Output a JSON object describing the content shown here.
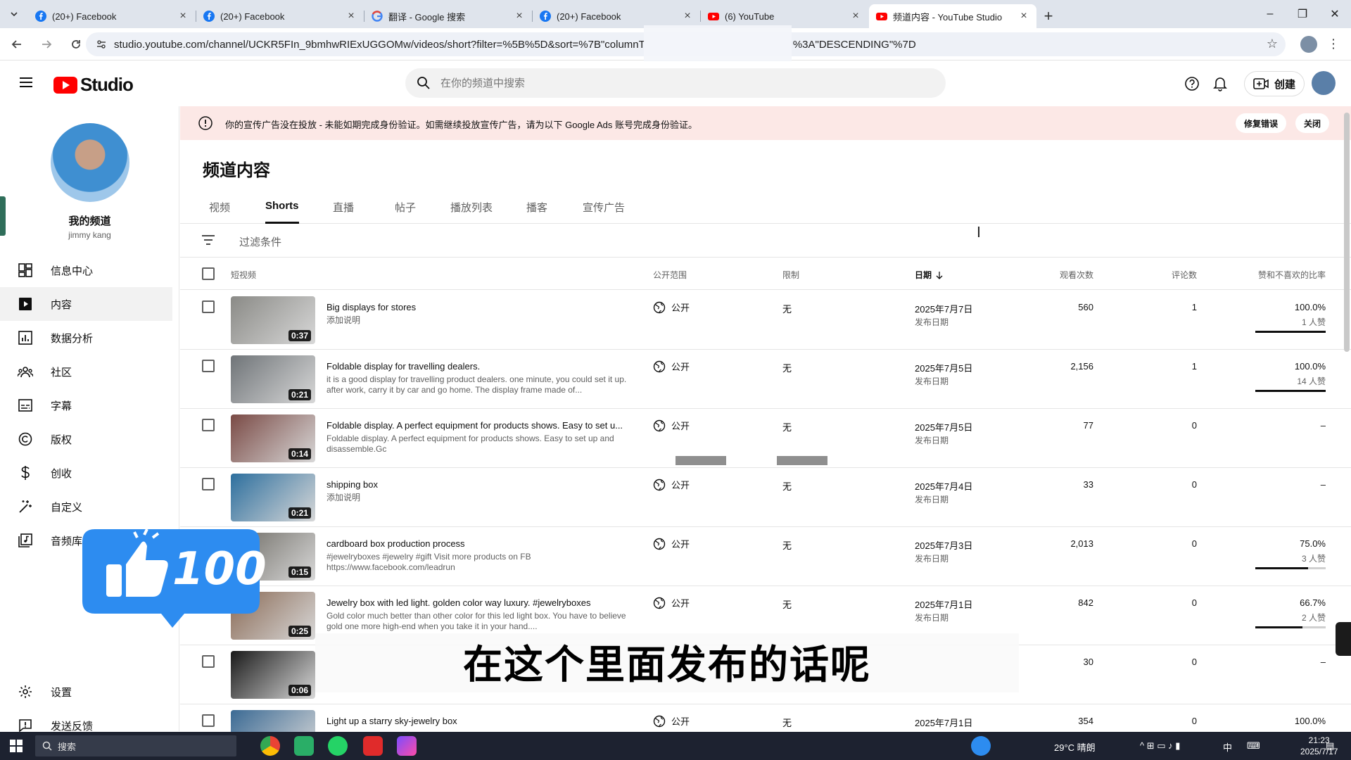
{
  "browser": {
    "tabs": [
      {
        "title": "(20+) Facebook",
        "icon": "facebook-icon"
      },
      {
        "title": "(20+) Facebook",
        "icon": "facebook-icon"
      },
      {
        "title": "翻译 - Google 搜索",
        "icon": "google-icon"
      },
      {
        "title": "(20+) Facebook",
        "icon": "facebook-icon"
      },
      {
        "title": "(6) YouTube",
        "icon": "youtube-icon"
      },
      {
        "title": "频道内容 - YouTube Studio",
        "icon": "youtube-studio-icon"
      }
    ],
    "url_start": "studio.youtube.com/channel/UCKR5FIn_9bmhwRIExUGGOMw/videos/short?filter=%5B%5D&sort=%7B\"columnT",
    "url_end": "%3A\"DESCENDING\"%7D"
  },
  "header": {
    "logo_text": "Studio",
    "search_placeholder": "在你的频道中搜索",
    "create_label": "创建"
  },
  "sidebar": {
    "channel_title": "我的频道",
    "channel_name": "jimmy kang",
    "items": [
      {
        "label": "信息中心"
      },
      {
        "label": "内容"
      },
      {
        "label": "数据分析"
      },
      {
        "label": "社区"
      },
      {
        "label": "字幕"
      },
      {
        "label": "版权"
      },
      {
        "label": "创收"
      },
      {
        "label": "自定义"
      },
      {
        "label": "音频库"
      }
    ],
    "settings_label": "设置",
    "feedback_label": "发送反馈"
  },
  "banner": {
    "message": "你的宣传广告没在投放 - 未能如期完成身份验证。如需继续投放宣传广告，请为以下 Google Ads 账号完成身份验证。",
    "fix_label": "修复错误",
    "close_label": "关闭"
  },
  "content": {
    "page_title": "频道内容",
    "tabs": [
      "视频",
      "Shorts",
      "直播",
      "帖子",
      "播放列表",
      "播客",
      "宣传广告"
    ],
    "filter_placeholder": "过滤条件",
    "columns": {
      "video": "短视频",
      "visibility": "公开范围",
      "restrictions": "限制",
      "date": "日期",
      "views": "观看次数",
      "comments": "评论数",
      "like_ratio": "赞和不喜欢的比率"
    },
    "rows": [
      {
        "duration": "0:37",
        "title": "Big displays for stores",
        "desc": "添加说明",
        "visibility": "公开",
        "restriction": "无",
        "date": "2025年7月7日",
        "date_sub": "发布日期",
        "views": "560",
        "comments": "1",
        "ratio": "100.0%",
        "likes": "1 人赞",
        "ratio_value": 1.0,
        "thumb": "#8a8a86"
      },
      {
        "duration": "0:21",
        "title": "Foldable display for travelling dealers.",
        "desc": "it is a good display for travelling product dealers. one minute, you could set it up. after work, carry it by car and go home. The display frame made of...",
        "visibility": "公开",
        "restriction": "无",
        "date": "2025年7月5日",
        "date_sub": "发布日期",
        "views": "2,156",
        "comments": "1",
        "ratio": "100.0%",
        "likes": "14 人赞",
        "ratio_value": 1.0,
        "thumb": "#6f7478"
      },
      {
        "duration": "0:14",
        "title": "Foldable display. A perfect equipment for products shows. Easy to set u...",
        "desc": "Foldable display. A perfect equipment for products shows. Easy to set up and disassemble.Gc",
        "visibility": "公开",
        "restriction": "无",
        "date": "2025年7月5日",
        "date_sub": "发布日期",
        "views": "77",
        "comments": "0",
        "ratio": "–",
        "likes": "",
        "ratio_value": null,
        "thumb": "#7a4a45"
      },
      {
        "duration": "0:21",
        "title": "shipping box",
        "desc": "添加说明",
        "visibility": "公开",
        "restriction": "无",
        "date": "2025年7月4日",
        "date_sub": "发布日期",
        "views": "33",
        "comments": "0",
        "ratio": "–",
        "likes": "",
        "ratio_value": null,
        "thumb": "#2d6f9e"
      },
      {
        "duration": "0:15",
        "title": "cardboard box production process",
        "desc": "#jewelryboxes #jewelry #gift Visit more products on FB https://www.facebook.com/leadrun",
        "visibility": "公开",
        "restriction": "无",
        "date": "2025年7月3日",
        "date_sub": "发布日期",
        "views": "2,013",
        "comments": "0",
        "ratio": "75.0%",
        "likes": "3 人赞",
        "ratio_value": 0.75,
        "thumb": "#6d6a63"
      },
      {
        "duration": "0:25",
        "title": "Jewelry box with led light. golden color way luxury. #jewelryboxes",
        "desc": "Gold color much better than other color for this led light box. You have to believe gold one more high-end when you take it in your hand....",
        "visibility": "公开",
        "restriction": "无",
        "date": "2025年7月1日",
        "date_sub": "发布日期",
        "views": "842",
        "comments": "0",
        "ratio": "66.7%",
        "likes": "2 人赞",
        "ratio_value": 0.667,
        "thumb": "#8a6a55"
      },
      {
        "duration": "0:06",
        "title": "",
        "desc": "",
        "visibility": "",
        "restriction": "",
        "date": "",
        "date_sub": "",
        "views": "30",
        "comments": "0",
        "ratio": "–",
        "likes": "",
        "ratio_value": null,
        "thumb": "#1a1a1a"
      },
      {
        "duration": "",
        "title": "Light up a starry sky-jewelry box",
        "desc": "",
        "visibility": "公开",
        "restriction": "无",
        "date": "2025年7月1日",
        "date_sub": "",
        "views": "354",
        "comments": "0",
        "ratio": "100.0%",
        "likes": "",
        "ratio_value": null,
        "thumb": "#3b6a94"
      }
    ]
  },
  "overlay": {
    "subtitle": "在这个里面发布的话呢",
    "sticker_count": "100"
  },
  "taskbar": {
    "search_label": "搜索",
    "weather": "29°C 晴朗",
    "ime": "中",
    "time": "21:23",
    "date": "2025/7/17"
  }
}
